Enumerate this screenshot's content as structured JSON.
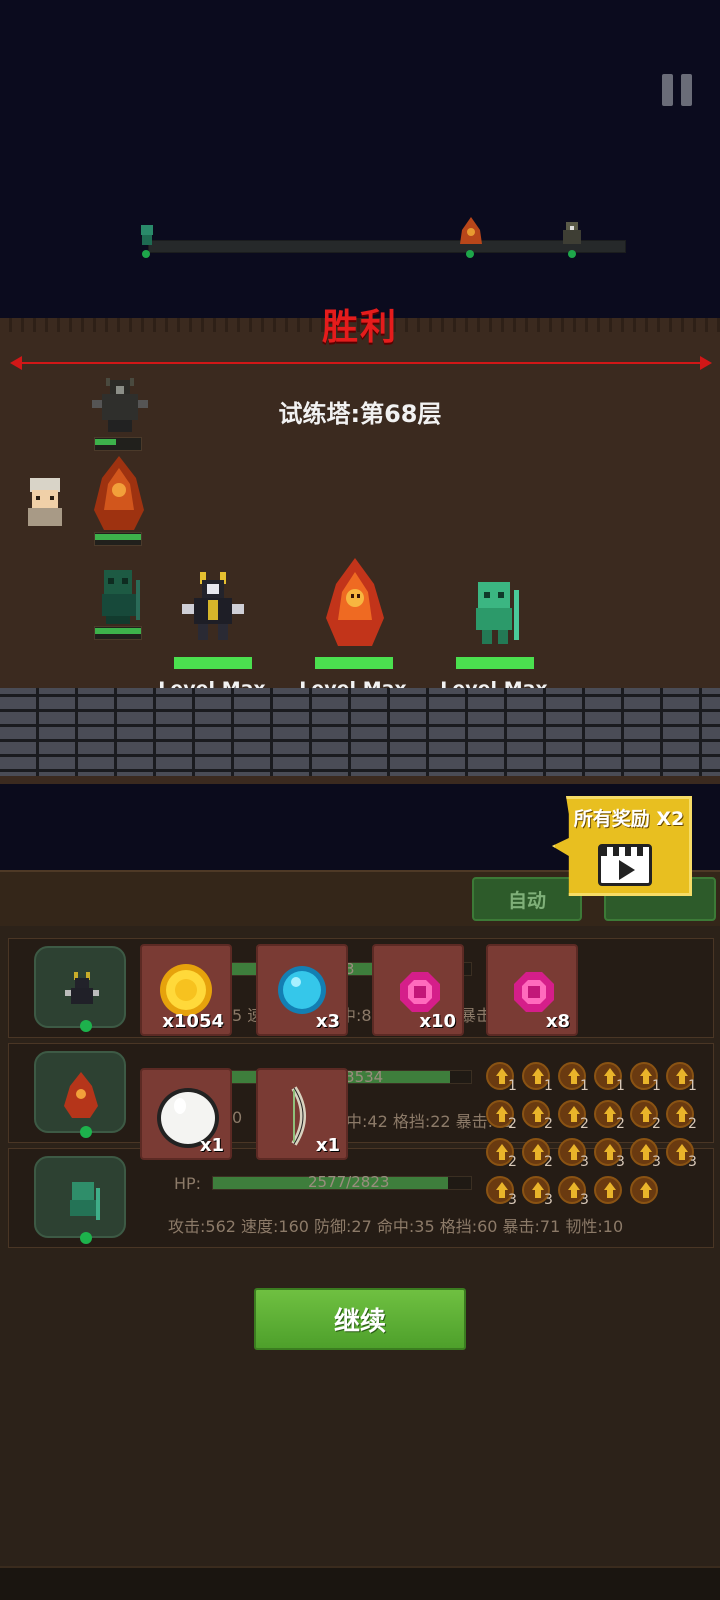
{
  "battle": {
    "result_title": "胜利",
    "tower_floor": "试练塔:第68层",
    "allies": [
      {
        "name": "bone-knight",
        "level_label": "Level Max",
        "hp_fraction": 1.0
      },
      {
        "name": "fire-elemental",
        "level_label": "Level Max",
        "hp_fraction": 1.0
      },
      {
        "name": "swamp-goblin",
        "level_label": "Level Max",
        "hp_fraction": 1.0
      }
    ],
    "enemy_hp_fractions": [
      0.45,
      1.0,
      1.0
    ]
  },
  "controls": {
    "auto_tab": "自动",
    "continue": "继续",
    "double_rewards": "所有奖励 X2"
  },
  "rewards": [
    {
      "icon": "gold-coin-icon",
      "count": "x1054"
    },
    {
      "icon": "blue-orb-icon",
      "count": "x3"
    },
    {
      "icon": "pink-gem-icon",
      "count": "x10"
    },
    {
      "icon": "pink-gem-icon",
      "count": "x8"
    },
    {
      "icon": "white-egg-icon",
      "count": "x1"
    },
    {
      "icon": "bone-bow-icon",
      "count": "x1"
    }
  ],
  "heroes": [
    {
      "hp_text": "/3",
      "stats": "5 速",
      "stats_b": "中:8",
      "stats_c": "暴击",
      "hp_fraction": 0.95
    },
    {
      "hp_text": "/3534",
      "stats": "0",
      "stats_b": "中:42 格挡:22 暴击:71",
      "hp_fraction": 0.92
    },
    {
      "hp_label": "HP:",
      "hp_text": "2577/2823",
      "stats": "攻击:562 速度:160 防御:27 命中:35 格挡:60 暴击:71 韧性:10",
      "hp_fraction": 0.91
    }
  ],
  "upgrade_levels": [
    "1",
    "1",
    "1",
    "1",
    "1",
    "1",
    "2",
    "2",
    "2",
    "2",
    "2",
    "2",
    "2",
    "2",
    "3",
    "3",
    "3",
    "3",
    "3",
    "3",
    "3",
    "",
    ""
  ]
}
